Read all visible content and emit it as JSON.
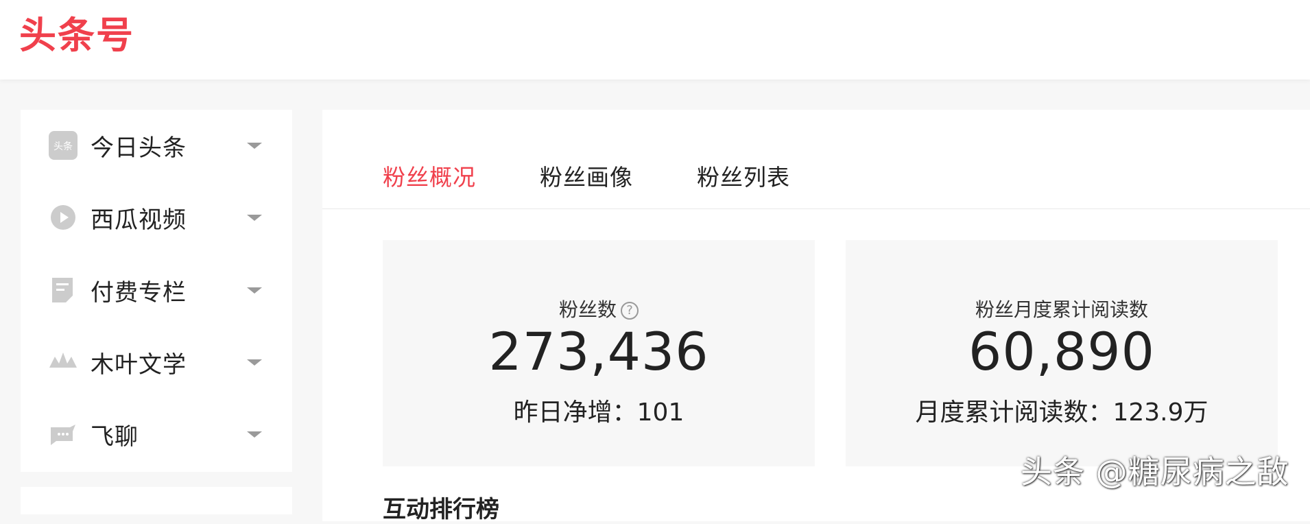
{
  "header": {
    "logo": "头条号"
  },
  "sidebar": {
    "items": [
      {
        "label": "今日头条",
        "icon": "toutiao-icon"
      },
      {
        "label": "西瓜视频",
        "icon": "xigua-icon"
      },
      {
        "label": "付费专栏",
        "icon": "paid-column-icon"
      },
      {
        "label": "木叶文学",
        "icon": "muye-literature-icon"
      },
      {
        "label": "飞聊",
        "icon": "feiliao-icon"
      }
    ]
  },
  "tabs": [
    {
      "label": "粉丝概况",
      "active": true
    },
    {
      "label": "粉丝画像",
      "active": false
    },
    {
      "label": "粉丝列表",
      "active": false
    }
  ],
  "stats": {
    "fans": {
      "title": "粉丝数",
      "value": "273,436",
      "sub": "昨日净增：101"
    },
    "monthly_reads": {
      "title": "粉丝月度累计阅读数",
      "value": "60,890",
      "sub": "月度累计阅读数：123.9万"
    }
  },
  "next_section_title": "互动排行榜",
  "watermark": "头条 @糖尿病之敌",
  "colors": {
    "accent": "#f0404c",
    "card_bg": "#f7f7f7",
    "icon_gray": "#cccccc"
  }
}
